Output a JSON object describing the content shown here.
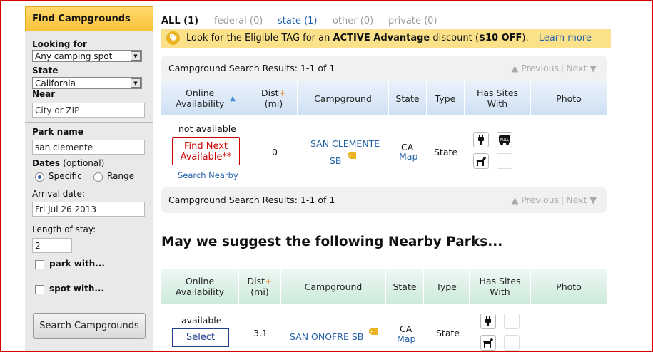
{
  "sidebar": {
    "title": "Find Campgrounds",
    "looking_for_label": "Looking for",
    "looking_for_value": "Any camping spot",
    "state_label": "State",
    "state_value": "California",
    "near_label": "Near",
    "near_placeholder": "City or ZIP",
    "park_name_label": "Park name",
    "park_name_value": "san clemente",
    "dates_label": "Dates",
    "dates_optional": "(optional)",
    "radio_specific": "Specific",
    "radio_range": "Range",
    "dates_mode": "specific",
    "arrival_label": "Arrival date:",
    "arrival_value": "Fri Jul 26 2013",
    "length_label": "Length of stay:",
    "length_value": "2",
    "park_with": "park with...",
    "spot_with": "spot with...",
    "search_button": "Search Campgrounds"
  },
  "tabs": [
    {
      "label": "ALL (1)",
      "state": "active"
    },
    {
      "label": "federal (0)",
      "state": "disabled"
    },
    {
      "label": "state (1)",
      "state": "link"
    },
    {
      "label": "other (0)",
      "state": "disabled"
    },
    {
      "label": "private (0)",
      "state": "disabled"
    }
  ],
  "banner": {
    "text_pre": "Look for the Eligible TAG for an ",
    "text_bold1": "ACTIVE Advantage",
    "text_mid": " discount (",
    "text_bold2": "$10 OFF",
    "text_post": ").",
    "learn_more": "Learn more"
  },
  "results_bar": {
    "text": "Campground Search Results: 1-1 of 1",
    "previous": "▲ Previous",
    "separator": "|",
    "next": "Next ▼"
  },
  "columns": {
    "online1": "Online",
    "online2": "Availability",
    "dist1": "Dist",
    "dist_plus": "+",
    "dist2": "(mi)",
    "campground": "Campground",
    "state": "State",
    "type": "Type",
    "sites1": "Has Sites",
    "sites2": "With",
    "photo": "Photo"
  },
  "result_row": {
    "availability": "not available",
    "find_next1": "Find Next",
    "find_next2": "Available**",
    "search_nearby": "Search Nearby",
    "distance": "0",
    "name1": "SAN CLEMENTE",
    "name2": "SB",
    "state": "CA",
    "map": "Map",
    "type": "State"
  },
  "suggest_heading": "May we suggest the following Nearby Parks...",
  "nearby_row": {
    "availability": "available",
    "select": "Select",
    "distance": "3.1",
    "name": "SAN ONOFRE SB",
    "state": "CA",
    "map": "Map",
    "type": "State"
  },
  "colors": {
    "accent_yellow": "#f9c23c",
    "link_blue": "#2563a8",
    "find_red": "#cc0000",
    "header_blue": "#cfe0f3",
    "header_green": "#cce9db"
  },
  "icons": [
    "electric-plug-icon",
    "full-hookup-icon",
    "pet-dog-icon"
  ]
}
